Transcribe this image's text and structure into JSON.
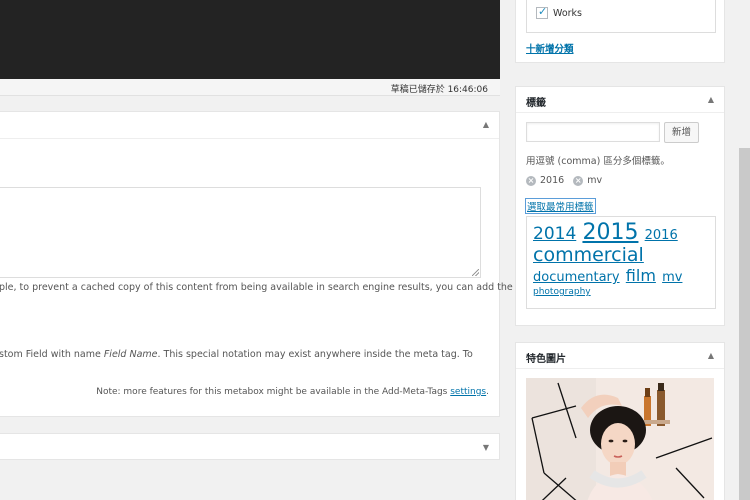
{
  "draft_status": "草稿已儲存於 16:46:06",
  "meta_box": {
    "text_line1": "ple, to prevent a cached copy of this content from being available in search engine results, you can add the",
    "text_line2_a": "stom Field with name ",
    "text_line2_field": "Field Name",
    "text_line2_b": ". This special notation may exist anywhere inside the meta tag. To",
    "note_prefix": "Note: more features for this metabox might be available in the Add-Meta-Tags ",
    "note_link": "settings",
    "note_suffix": "."
  },
  "categories": {
    "items": [
      {
        "label": "Works",
        "checked": true
      }
    ],
    "add_link": "十新增分類"
  },
  "tags": {
    "title": "標籤",
    "input_value": "",
    "add_button": "新增",
    "hint": "用逗號 (comma) 區分多個標籤。",
    "chosen": [
      "2016",
      "mv"
    ],
    "popular_link": "選取最常用標籤",
    "cloud": [
      {
        "label": "2014",
        "size": "17px"
      },
      {
        "label": "2015",
        "size": "22px"
      },
      {
        "label": "2016",
        "size": "13px"
      },
      {
        "label": "commercial",
        "size": "19px"
      },
      {
        "label": "documentary",
        "size": "13px"
      },
      {
        "label": "film",
        "size": "16px"
      },
      {
        "label": "mv",
        "size": "13px"
      },
      {
        "label": "photography",
        "size": "9px"
      }
    ]
  },
  "featured": {
    "title": "特色圖片"
  },
  "colors": {
    "link": "#0073aa",
    "dark_editor": "#232323"
  }
}
